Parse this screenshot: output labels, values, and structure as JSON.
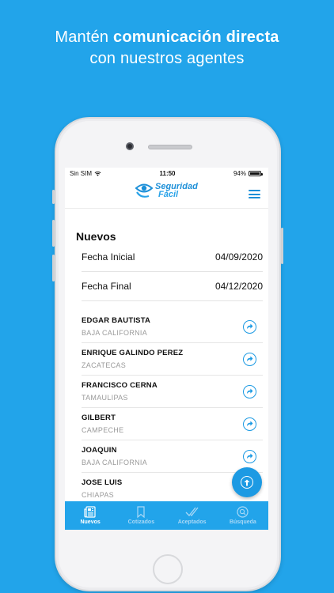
{
  "promo": {
    "line1_pre": "Mantén ",
    "line1_bold": "comunicación directa",
    "line2": "con nuestros agentes"
  },
  "status": {
    "carrier": "Sin SIM",
    "time": "11:50",
    "battery": "94%"
  },
  "logo": {
    "line1": "Seguridad",
    "line2": "Fácil"
  },
  "page": {
    "title": "Nuevos",
    "fecha_inicial_label": "Fecha Inicial",
    "fecha_inicial_value": "04/09/2020",
    "fecha_final_label": "Fecha Final",
    "fecha_final_value": "04/12/2020"
  },
  "items": [
    {
      "name": "EDGAR BAUTISTA",
      "state": "BAJA CALIFORNIA"
    },
    {
      "name": "ENRIQUE GALINDO PEREZ",
      "state": "ZACATECAS"
    },
    {
      "name": "FRANCISCO CERNA",
      "state": "TAMAULIPAS"
    },
    {
      "name": "GILBERT",
      "state": "CAMPECHE"
    },
    {
      "name": "JOAQUIN",
      "state": "BAJA CALIFORNIA"
    },
    {
      "name": "JOSE LUIS",
      "state": "CHIAPAS"
    }
  ],
  "tabs": [
    {
      "label": "Nuevos",
      "icon": "newspaper-icon"
    },
    {
      "label": "Cotizados",
      "icon": "bookmark-icon"
    },
    {
      "label": "Aceptados",
      "icon": "double-check-icon"
    },
    {
      "label": "Búsqueda",
      "icon": "search-icon"
    }
  ],
  "colors": {
    "background": "#22a4ea",
    "accent": "#1c9ae3"
  }
}
